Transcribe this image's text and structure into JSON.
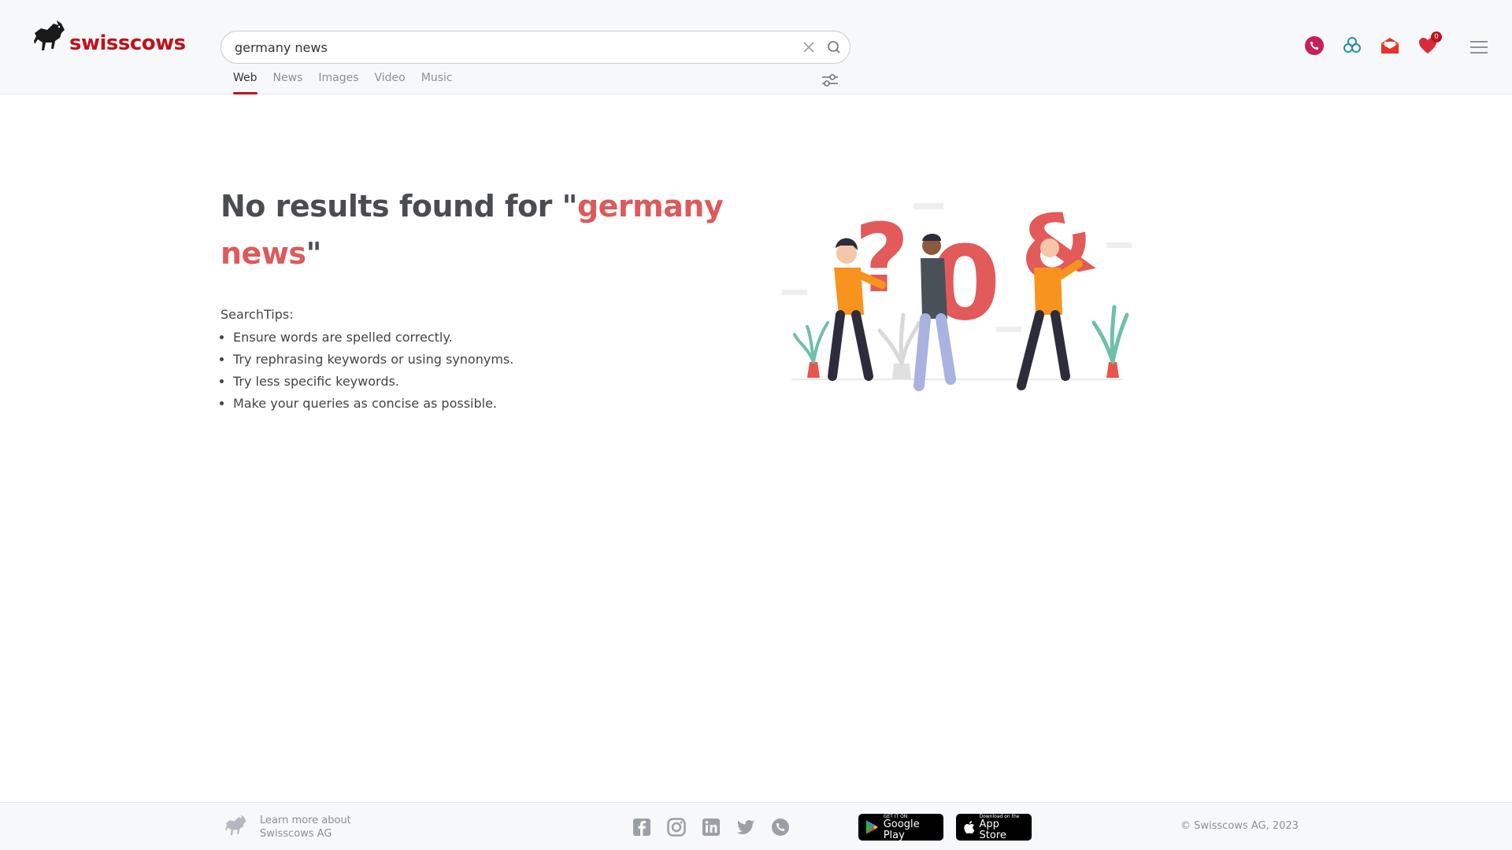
{
  "brand": {
    "name": "swisscows",
    "color": "#c0121a",
    "accent_text": "#dd5a5a"
  },
  "search": {
    "value": "germany news",
    "placeholder": ""
  },
  "tabs": [
    {
      "label": "Web",
      "active": true
    },
    {
      "label": "News",
      "active": false
    },
    {
      "label": "Images",
      "active": false
    },
    {
      "label": "Video",
      "active": false
    },
    {
      "label": "Music",
      "active": false
    }
  ],
  "header_icons": {
    "favorites_count": "0"
  },
  "results": {
    "title_prefix": "No results found for \"",
    "title_query": "germany news",
    "title_suffix": "\"",
    "tips_label": "SearchTips:",
    "tips": [
      "Ensure words are spelled correctly.",
      "Try rephrasing keywords or using synonyms.",
      "Try less specific keywords.",
      "Make your queries as concise as possible."
    ]
  },
  "footer": {
    "learn_line1": "Learn more about",
    "learn_line2": "Swisscows AG",
    "google_play_small": "GET IT ON",
    "google_play_big": "Google Play",
    "app_store_small": "Download on the",
    "app_store_big": "App Store",
    "copyright": "© Swisscows AG, 2023"
  }
}
